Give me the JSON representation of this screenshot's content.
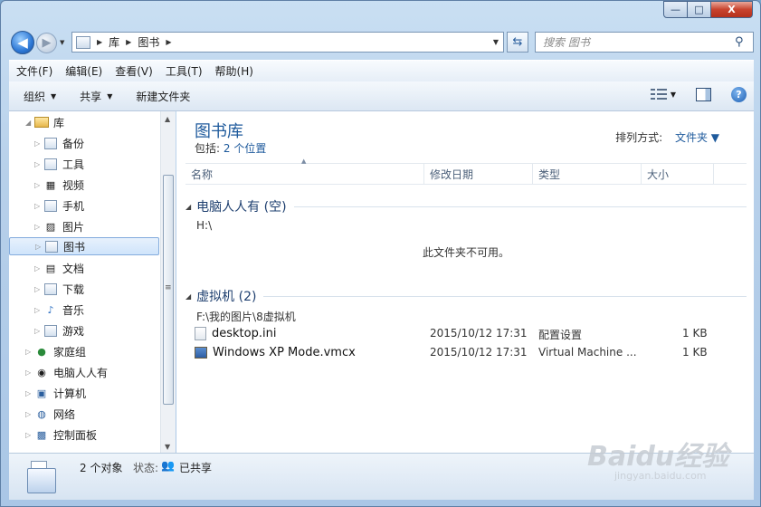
{
  "window": {
    "caption": {
      "minimize": "—",
      "maximize": "□",
      "close": "X"
    }
  },
  "address": {
    "crumbs": [
      "库",
      "图书"
    ],
    "search_placeholder": "搜索 图书"
  },
  "menu": [
    "文件(F)",
    "编辑(E)",
    "查看(V)",
    "工具(T)",
    "帮助(H)"
  ],
  "commands": {
    "organize": "组织",
    "share": "共享",
    "new_folder": "新建文件夹",
    "help": "?"
  },
  "nav_tree": [
    {
      "label": "库"
    },
    {
      "label": "备份"
    },
    {
      "label": "工具"
    },
    {
      "label": "视频"
    },
    {
      "label": "手机"
    },
    {
      "label": "图片"
    },
    {
      "label": "图书"
    },
    {
      "label": "文档"
    },
    {
      "label": "下载"
    },
    {
      "label": "音乐"
    },
    {
      "label": "游戏"
    },
    {
      "label": "家庭组"
    },
    {
      "label": "电脑人人有"
    },
    {
      "label": "计算机"
    },
    {
      "label": "网络"
    },
    {
      "label": "控制面板"
    }
  ],
  "library": {
    "title": "图书库",
    "includes_label": "包括:",
    "includes_link": "2 个位置",
    "arrange_label": "排列方式:",
    "arrange_value": "文件夹"
  },
  "columns": [
    "名称",
    "修改日期",
    "类型",
    "大小"
  ],
  "groups": [
    {
      "title": "电脑人人有 (空)",
      "path": "H:\\",
      "empty_message": "此文件夹不可用。"
    },
    {
      "title": "虚拟机 (2)",
      "path": "F:\\我的图片\\8虚拟机"
    }
  ],
  "files": [
    {
      "name": "desktop.ini",
      "date": "2015/10/12 17:31",
      "type": "配置设置",
      "size": "1 KB"
    },
    {
      "name": "Windows XP Mode.vmcx",
      "date": "2015/10/12 17:31",
      "type": "Virtual Machine ...",
      "size": "1 KB"
    }
  ],
  "status": {
    "count": "2 个对象",
    "state_label": "状态:",
    "state_value": "已共享"
  },
  "watermark": {
    "top": "Baidu经验",
    "bottom": "jingyan.baidu.com"
  },
  "colors": {
    "accent": "#1e5a9c",
    "selection": "#cfe4fb"
  }
}
